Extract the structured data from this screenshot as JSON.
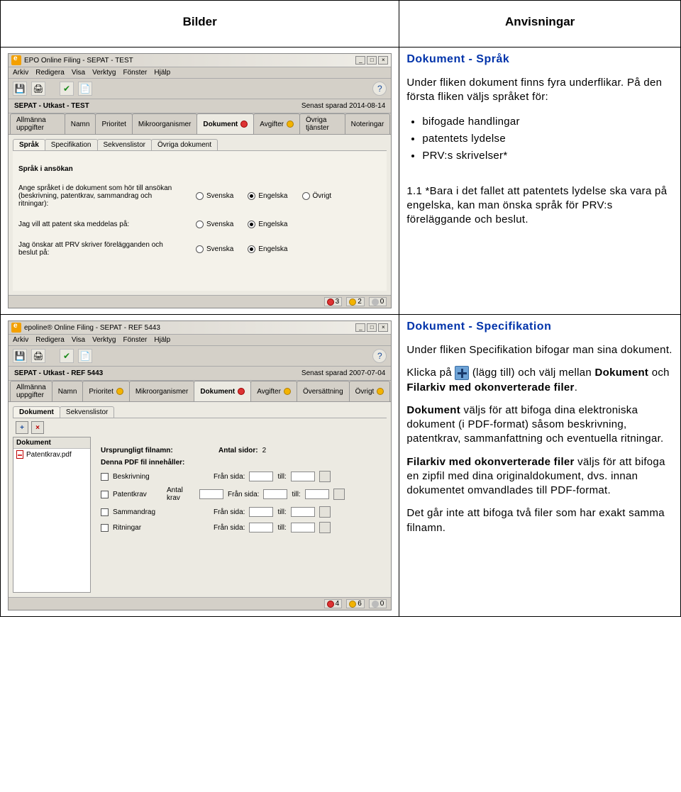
{
  "headers": {
    "left": "Bilder",
    "right": "Anvisningar"
  },
  "row1": {
    "app": {
      "title": "EPO Online Filing - SEPAT - TEST",
      "menus": [
        "Arkiv",
        "Redigera",
        "Visa",
        "Verktyg",
        "Fönster",
        "Hjälp"
      ],
      "subheader_left": "SEPAT - Utkast - TEST",
      "subheader_right": "Senast sparad 2014-08-14",
      "tabs": [
        "Allmänna uppgifter",
        "Namn",
        "Prioritet",
        "Mikroorganismer",
        "Dokument",
        "Avgifter",
        "Övriga tjänster",
        "Noteringar"
      ],
      "active_tab": "Dokument",
      "subtabs": [
        "Språk",
        "Specifikation",
        "Sekvenslistor",
        "Övriga dokument"
      ],
      "active_subtab": "Språk",
      "panel_heading": "Språk i ansökan",
      "field1_label": "Ange språket i de dokument som hör till ansökan\n(beskrivning, patentkrav, sammandrag och ritningar):",
      "field1_options": [
        "Svenska",
        "Engelska",
        "Övrigt"
      ],
      "field1_selected": "Engelska",
      "field2_label": "Jag vill att patent ska meddelas på:",
      "field2_options": [
        "Svenska",
        "Engelska"
      ],
      "field2_selected": "Engelska",
      "field3_label": "Jag önskar att PRV skriver förelägganden och beslut på:",
      "field3_options": [
        "Svenska",
        "Engelska"
      ],
      "field3_selected": "Engelska",
      "status": {
        "err": "3",
        "warn": "2",
        "info": "0"
      }
    },
    "instr": {
      "title": "Dokument - Språk",
      "p1": "Under fliken dokument finns fyra underflikar. På den första fliken väljs språket för:",
      "bullets": [
        "bifogade handlingar",
        "patentets lydelse",
        "PRV:s skrivelser*"
      ],
      "p2": "1.1 *Bara i det fallet att patentets lydelse ska vara på engelska, kan man önska språk för PRV:s föreläggande och beslut."
    }
  },
  "row2": {
    "app": {
      "title": "epoline® Online Filing - SEPAT - REF 5443",
      "menus": [
        "Arkiv",
        "Redigera",
        "Visa",
        "Verktyg",
        "Fönster",
        "Hjälp"
      ],
      "subheader_left": "SEPAT - Utkast - REF 5443",
      "subheader_right": "Senast sparad 2007-07-04",
      "tabs": [
        "Allmänna uppgifter",
        "Namn",
        "Prioritet",
        "Mikroorganismer",
        "Dokument",
        "Avgifter",
        "Översättning",
        "Övrigt"
      ],
      "active_tab": "Dokument",
      "subtabs": [
        "Dokument",
        "Sekvenslistor"
      ],
      "active_subtab": "Dokument",
      "list_header": "Dokument",
      "list_item": "Patentkrav.pdf",
      "form": {
        "orig_label": "Ursprungligt filnamn:",
        "pages_label": "Antal sidor:",
        "pages_value": "2",
        "contains_label": "Denna PDF fil innehåller:",
        "rows": [
          {
            "cb": "Beskrivning",
            "from": "Från sida:",
            "to": "till:"
          },
          {
            "cb": "Patentkrav",
            "extra": "Antal krav",
            "from": "Från sida:",
            "to": "till:"
          },
          {
            "cb": "Sammandrag",
            "from": "Från sida:",
            "to": "till:"
          },
          {
            "cb": "Ritningar",
            "from": "Från sida:",
            "to": "till:"
          }
        ]
      },
      "status": {
        "err": "4",
        "warn": "6",
        "info": "0"
      }
    },
    "instr": {
      "title": "Dokument - Specifikation",
      "p1": "Under fliken Specifikation bifogar man sina dokument.",
      "p2a": "Klicka på ",
      "p2b": " (lägg till) och välj mellan ",
      "p2_bold1": "Dokument",
      "p2c": " och ",
      "p2_bold2": "Filarkiv med okonverterade filer",
      "p2d": ".",
      "p3_bold": "Dokument",
      "p3": " väljs för att bifoga dina elektroniska dokument (i PDF-format) såsom beskrivning, patentkrav, sammanfattning och eventuella ritningar.",
      "p4_bold": "Filarkiv med okonverterade filer",
      "p4": " väljs för att bifoga en zipfil med dina originaldokument, dvs. innan dokumentet omvandlades till PDF-format.",
      "p5": "Det går inte att bifoga två filer som har exakt samma filnamn."
    }
  }
}
